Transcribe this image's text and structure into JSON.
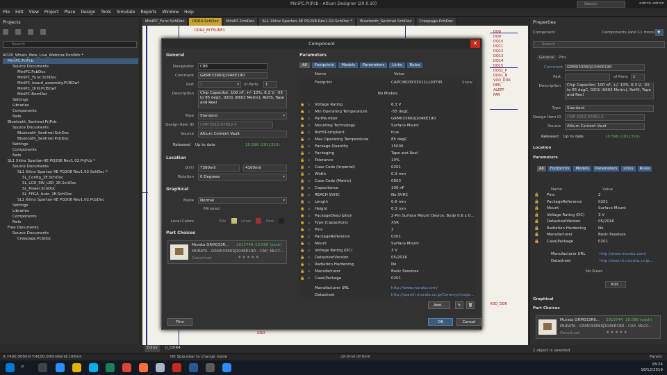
{
  "app": {
    "window_title": "MiniPC.PrjPcb - Altium Designer (20.0.10)",
    "search_placeholder": "Search",
    "user": "admin.admin"
  },
  "menu": [
    "File",
    "Edit",
    "View",
    "Project",
    "Place",
    "Design",
    "Tools",
    "Simulate",
    "Reports",
    "Window",
    "Help"
  ],
  "doc_tabs": [
    "MiniPC_Func.SchDoc",
    "DDR4.SchDoc",
    "MiniPC.PcbDoc",
    "SL1 Xilinx Spartan-IIE PQ208 Rev1.02.SchDoc *",
    "Bluetooth_Sentinel.SchDoc",
    "Creepage.PcbDoc"
  ],
  "projects_panel": {
    "title": "Projects",
    "search_placeholder": "Search",
    "tree": [
      {
        "label": "AD20_Whats_New_Live_Webinar.DsnWrk *",
        "indent": 0,
        "sel": false
      },
      {
        "label": "MiniPC.PrjPcb",
        "indent": 1,
        "sel": true
      },
      {
        "label": "Source Documents",
        "indent": 2,
        "sel": false
      },
      {
        "label": "MiniPC.PcbDoc",
        "indent": 3,
        "sel": false
      },
      {
        "label": "MiniPC_Func.SchDoc",
        "indent": 3,
        "sel": false
      },
      {
        "label": "MiniPC_board_assembly.PCBDwf",
        "indent": 3,
        "sel": false
      },
      {
        "label": "MiniPC_Drill.PCBDwf",
        "indent": 3,
        "sel": false
      },
      {
        "label": "MiniPC.BomDoc",
        "indent": 3,
        "sel": false
      },
      {
        "label": "Settings",
        "indent": 2,
        "sel": false
      },
      {
        "label": "Libraries",
        "indent": 2,
        "sel": false
      },
      {
        "label": "Components",
        "indent": 2,
        "sel": false
      },
      {
        "label": "Nets",
        "indent": 2,
        "sel": false
      },
      {
        "label": "Bluetooth_Sentinel.PrjPcb",
        "indent": 1,
        "sel": false
      },
      {
        "label": "Source Documents",
        "indent": 2,
        "sel": false
      },
      {
        "label": "Bluetooth_Sentinel.SchDoc",
        "indent": 3,
        "sel": false
      },
      {
        "label": "Bluetooth_Sentinel.PcbDoc",
        "indent": 3,
        "sel": false
      },
      {
        "label": "Settings",
        "indent": 2,
        "sel": false
      },
      {
        "label": "Components",
        "indent": 2,
        "sel": false
      },
      {
        "label": "Nets",
        "indent": 2,
        "sel": false
      },
      {
        "label": "SL1 Xilinx Spartan-IIE PQ208 Rev1.02.PrjPcb *",
        "indent": 1,
        "sel": false
      },
      {
        "label": "Source Documents",
        "indent": 2,
        "sel": false
      },
      {
        "label": "SL1 Xilinx Spartan-IIE PQ208 Rev1.02.SchDoc *",
        "indent": 3,
        "sel": false
      },
      {
        "label": "SL_Config_2E.SchDoc",
        "indent": 4,
        "sel": false
      },
      {
        "label": "SL_LCD_SW_LED_2E.SchDoc",
        "indent": 4,
        "sel": false
      },
      {
        "label": "SL_Power.SchDoc",
        "indent": 4,
        "sel": false
      },
      {
        "label": "SL_FPGA_Auto_2E.SchDoc",
        "indent": 4,
        "sel": false
      },
      {
        "label": "SL1 Xilinx Spartan-IIE PQ208 Rev1.02.PcbDoc",
        "indent": 3,
        "sel": false
      },
      {
        "label": "Settings",
        "indent": 2,
        "sel": false
      },
      {
        "label": "Libraries",
        "indent": 2,
        "sel": false
      },
      {
        "label": "Components",
        "indent": 2,
        "sel": false
      },
      {
        "label": "Nets",
        "indent": 2,
        "sel": false
      },
      {
        "label": "Free Documents",
        "indent": 1,
        "sel": false
      },
      {
        "label": "Source Documents",
        "indent": 2,
        "sel": false
      },
      {
        "label": "Creepage.PcbDoc",
        "indent": 3,
        "sel": false
      }
    ],
    "bottom_tabs": [
      "Projects",
      "Navigator"
    ]
  },
  "canvas": {
    "tabs": [
      "Editor",
      "U_DDR4"
    ],
    "labels_left": [
      "DDR4_BYTELINE1",
      "DQ10",
      "DQ11",
      "DQ12",
      "DQ13",
      "DQ14",
      "DQ15"
    ],
    "labels_right": [
      "DQ8",
      "DQ9",
      "DQ10",
      "DQ11",
      "DQ12",
      "DQ13",
      "DQ14",
      "DQ15",
      "DQS1_P",
      "DQS1_N",
      "VDD_DDR",
      "DM1",
      "ALERT",
      "PAR"
    ],
    "gnd": "GND",
    "vdd": "VDD_DDR"
  },
  "dialog": {
    "title": "Component",
    "general": {
      "header": "General",
      "designator_label": "Designator",
      "designator": "C88",
      "comment_label": "Comment",
      "comment": "GRM033R60J104KE19D",
      "part_label": "Part",
      "part_value": "1",
      "of_parts_label": "of Parts",
      "of_parts": "1",
      "description_label": "Description",
      "description": "Chip Capacitor, 100 nF, +/- 10%, 6.3 V, -55 to 85 degC, 0201 (0603 Metric), RoHS, Tape and Reel",
      "type_label": "Type",
      "type": "Standard",
      "design_item_label": "Design Item ID",
      "design_item": "CMP-2010-07852-4",
      "source_label": "Source",
      "source": "Altium Content Vault",
      "released": "Released",
      "up_to_date": "Up to date",
      "rev_badge": "10.598 (2911316)"
    },
    "location": {
      "header": "Location",
      "xy_label": "(X/Y)",
      "x": "7300mil",
      "y": "4100mil",
      "rotation_label": "Rotation",
      "rotation": "0 Degrees"
    },
    "graphical": {
      "header": "Graphical",
      "mode_label": "Mode",
      "mode": "Normal",
      "mirrored": "Mirrored",
      "local_colors_label": "Local Colors",
      "fills": "Fills",
      "lines": "Lines",
      "pins": "Pins"
    },
    "part_choices": {
      "header": "Part Choices",
      "name": "Murata GRM033R...",
      "stock": "2915744",
      "price": "10.098 (each)",
      "desc": "MURATA - GRM033R60J104KE19D - CAP, MLCC...",
      "datasheet": "Datasheet"
    },
    "parameters": {
      "header": "Parameters",
      "tabs": [
        "All",
        "Footprints",
        "Models",
        "Parameters",
        "Links",
        "Rules"
      ],
      "col_name": "Name",
      "col_value": "Value",
      "footprint_name": "Footprint",
      "footprint_value": "CAPC0603X33X11LL03T05",
      "show": "Show",
      "no_models": "No Models",
      "rows": [
        [
          "Voltage Rating",
          "6.3 V"
        ],
        [
          "Min Operating Temperature",
          "-55 degC"
        ],
        [
          "PartNumber",
          "GRM033R60J104KE19D"
        ],
        [
          "Mounting Technology",
          "Surface Mount"
        ],
        [
          "RoHSCompliant",
          "true"
        ],
        [
          "Max Operating Temperature",
          "85 degC"
        ],
        [
          "Package Quantity",
          "15000"
        ],
        [
          "Packaging",
          "Tape and Reel"
        ],
        [
          "Tolerance",
          "10%"
        ],
        [
          "Case Code (Imperial)",
          "0201"
        ],
        [
          "Width",
          "0.3 mm"
        ],
        [
          "Case Code (Metric)",
          "0603"
        ],
        [
          "Capacitance",
          "100 nF"
        ],
        [
          "REACH SVHC",
          "No SVHC"
        ],
        [
          "Length",
          "0.6 mm"
        ],
        [
          "Height",
          "0.3 mm"
        ],
        [
          "PackageDescription",
          "2-Pin Surface Mount Device, Body 0.6 x 0..."
        ],
        [
          "Type (Capacitors)",
          "X5R"
        ],
        [
          "Pins",
          "2"
        ],
        [
          "PackageReference",
          "0201"
        ],
        [
          "Mount",
          "Surface Mount"
        ],
        [
          "Voltage Rating (DC)",
          "3 V"
        ],
        [
          "DatasheetVersion",
          "05/2016"
        ],
        [
          "Radiation Hardening",
          "No"
        ],
        [
          "Manufacturer",
          "Basic Passives"
        ],
        [
          "Case\\Package",
          "0201"
        ]
      ],
      "links": [
        [
          "Manufacturer URL",
          "http://www.murata.com/"
        ],
        [
          "Datasheet",
          "http://search.murata.co.jp/Ceramy/image..."
        ]
      ],
      "add": "Add..."
    },
    "pins_button": "Pins",
    "ok": "OK",
    "cancel": "Cancel"
  },
  "properties_panel": {
    "title": "Properties",
    "component_label": "Component",
    "components_count": "Components (and 11 more)",
    "search_placeholder": "Search",
    "tabs": [
      "General",
      "Pins"
    ],
    "comment_label": "Comment",
    "comment": "GRM033R60J104KE19D",
    "part_label": "Part",
    "of_parts": "of Parts",
    "of_parts_val": "1",
    "description_label": "Description",
    "description": "Chip Capacitor, 100 nF, +/- 10%, 6.3 V, -55 to 85 degC, 0201 (0603 Metric), RoHS, Tape and Reel",
    "type_label": "Type",
    "type": "Standard",
    "design_item_label": "Design Item ID",
    "design_item": "CMP-2010-07852-4",
    "source_label": "Source",
    "source": "Altium Content Vault",
    "released": "Released",
    "up_to_date": "Up to date",
    "rev_badge": "10.598 (2911316)",
    "location_header": "Location",
    "parameters_header": "Parameters",
    "param_tabs": [
      "All",
      "Footprints",
      "Models",
      "Parameters",
      "Links",
      "Rules"
    ],
    "col_name": "Name",
    "col_value": "Value",
    "rows": [
      [
        "Pins",
        "2"
      ],
      [
        "PackageReference",
        "0201"
      ],
      [
        "Mount",
        "Surface Mount"
      ],
      [
        "Voltage Rating (DC)",
        "3 V"
      ],
      [
        "DatasheetVersion",
        "05/2016"
      ],
      [
        "Radiation Hardening",
        "No"
      ],
      [
        "Manufacturer",
        "Basic Passives"
      ],
      [
        "Case\\Package",
        "0201"
      ]
    ],
    "links": [
      [
        "Manufacturer URL",
        "http://www.murata.com/"
      ],
      [
        "Datasheet",
        "http://search.murata.co.jp..."
      ]
    ],
    "no_rules": "No Rules",
    "add": "Add...",
    "graphical_header": "Graphical",
    "part_choices_header": "Part Choices",
    "part_name": "Murata GRM033R6...",
    "part_stock": "2915744",
    "part_price": "10.098 (each)",
    "part_desc": "MURATA - GRM033R60J104KE19D - CAP, MLCC...",
    "part_datasheet": "Datasheet",
    "selected_status": "1 object is selected"
  },
  "status": {
    "coords": "X:7400.000mil Y:4100.000mil",
    "grid": "Grid:100mil",
    "hint": "Hit Spacebar to change mode",
    "delta": "dX:0mil dY:0mil",
    "panels": "Panels"
  },
  "taskbar": {
    "time": "18:24",
    "date": "18/12/2019"
  }
}
